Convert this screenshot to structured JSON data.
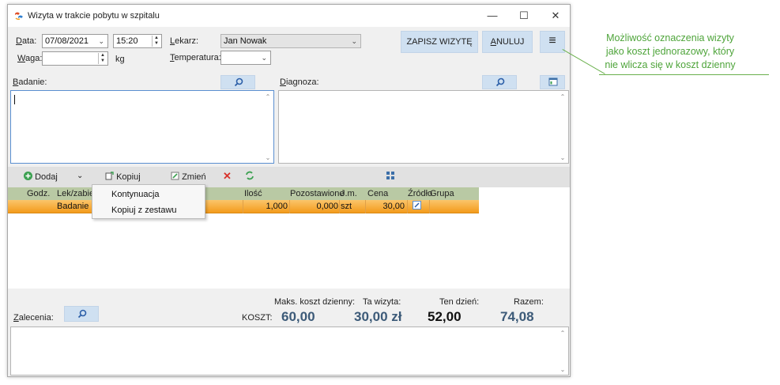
{
  "window": {
    "title": "Wizyta w trakcie pobytu w szpitalu",
    "controls": {
      "minimize": "—",
      "maximize": "☐",
      "close": "✕"
    }
  },
  "form": {
    "data_label_prefix": "D",
    "data_label_rest": "ata:",
    "date_value": "07/08/2021",
    "time_value": "15:20",
    "lekarz_label_prefix": "L",
    "lekarz_label_rest": "ekarz:",
    "lekarz_value": "Jan Nowak",
    "waga_label_prefix": "W",
    "waga_label_rest": "aga:",
    "waga_value": "",
    "waga_unit": "kg",
    "temp_label_prefix": "T",
    "temp_label_rest": "emperatura:",
    "temp_value": ""
  },
  "buttons": {
    "save": "ZAPISZ WIZYTĘ",
    "cancel_prefix": "A",
    "cancel_rest": "NULUJ",
    "menu": "≡"
  },
  "sections": {
    "badanie_prefix": "B",
    "badanie_rest": "adanie:",
    "diagnoza_prefix": "D",
    "diagnoza_rest": "iagnoza:",
    "zalecenia_prefix": "Z",
    "zalecenia_rest": "alecenia:"
  },
  "toolbar": {
    "add": "Dodaj",
    "copy": "Kopiuj",
    "change": "Zmień"
  },
  "grid": {
    "columns": [
      "Godz.",
      "Lek/zabie",
      "Ilość",
      "Pozostawione",
      "J.m.",
      "Cena",
      "Źródło",
      "Grupa"
    ],
    "row": {
      "godz": "",
      "lek": "Badanie r",
      "ilosc": "1,000",
      "pozostawione": "0,000",
      "jm": "szt",
      "cena": "30,00"
    }
  },
  "popup_menu": {
    "items": [
      "Kontynuacja",
      "Kopiuj z zestawu"
    ]
  },
  "costs": {
    "koszt_label": "KOSZT:",
    "max_label": "Maks. koszt dzienny:",
    "max_value": "60,00",
    "visit_label": "Ta wizyta:",
    "visit_value": "30,00 zł",
    "day_label": "Ten dzień:",
    "day_value": "52,00",
    "total_label": "Razem:",
    "total_value": "74,08"
  },
  "annotation": {
    "lines": [
      "Możliwość oznaczenia wizyty",
      "jako koszt jednorazowy, który",
      "nie wlicza się w koszt dzienny"
    ]
  },
  "colors": {
    "accent_button": "#cfe0f1",
    "grid_header": "#b9c9a4",
    "row_selected": "#f6a92e",
    "cost_blue": "#3c5a78",
    "annotation_green": "#4ea43a"
  }
}
